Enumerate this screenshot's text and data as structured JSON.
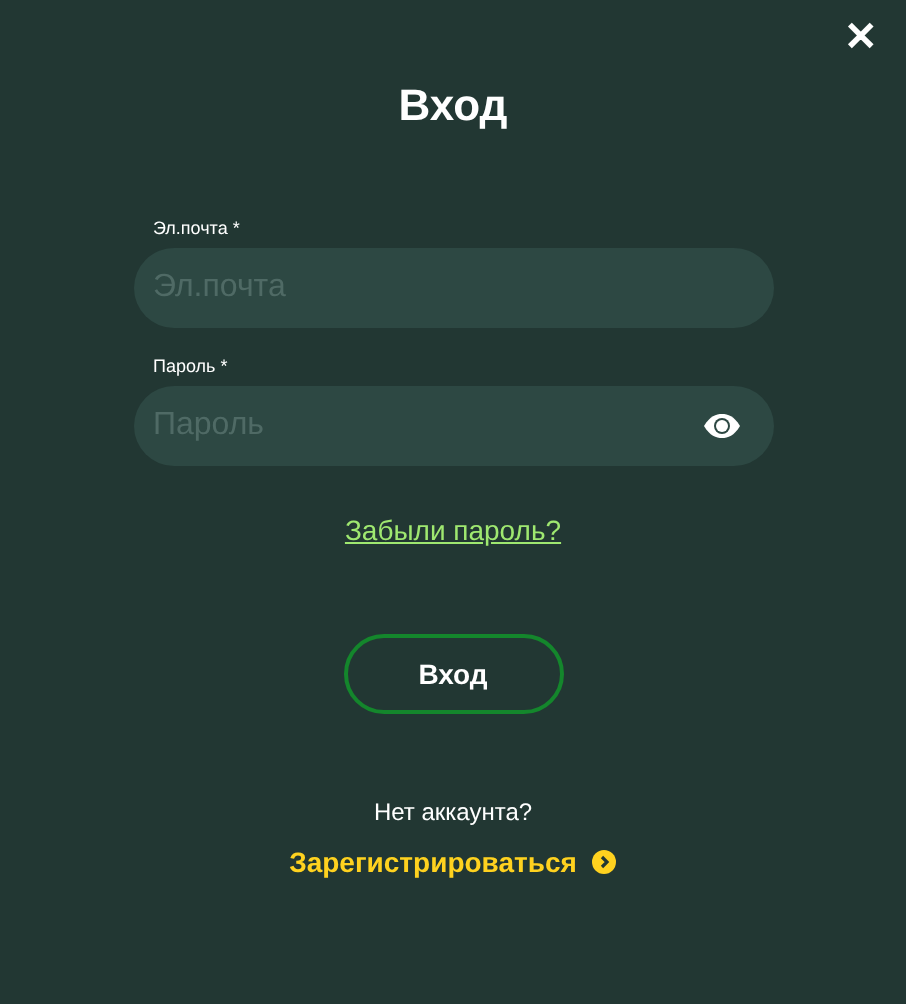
{
  "dialog": {
    "title": "Вход",
    "close": "✕"
  },
  "fields": [
    {
      "kind": "email",
      "label": "Эл.почта *",
      "placeholder": "Эл.почта"
    },
    {
      "kind": "password",
      "label": "Пароль *",
      "placeholder": "Пароль"
    }
  ],
  "forgot_link": "Забыли пароль?",
  "submit_button": "Вход",
  "signup_prompt": "Нет аккаунта?",
  "signup_link": "Зарегистрироваться"
}
